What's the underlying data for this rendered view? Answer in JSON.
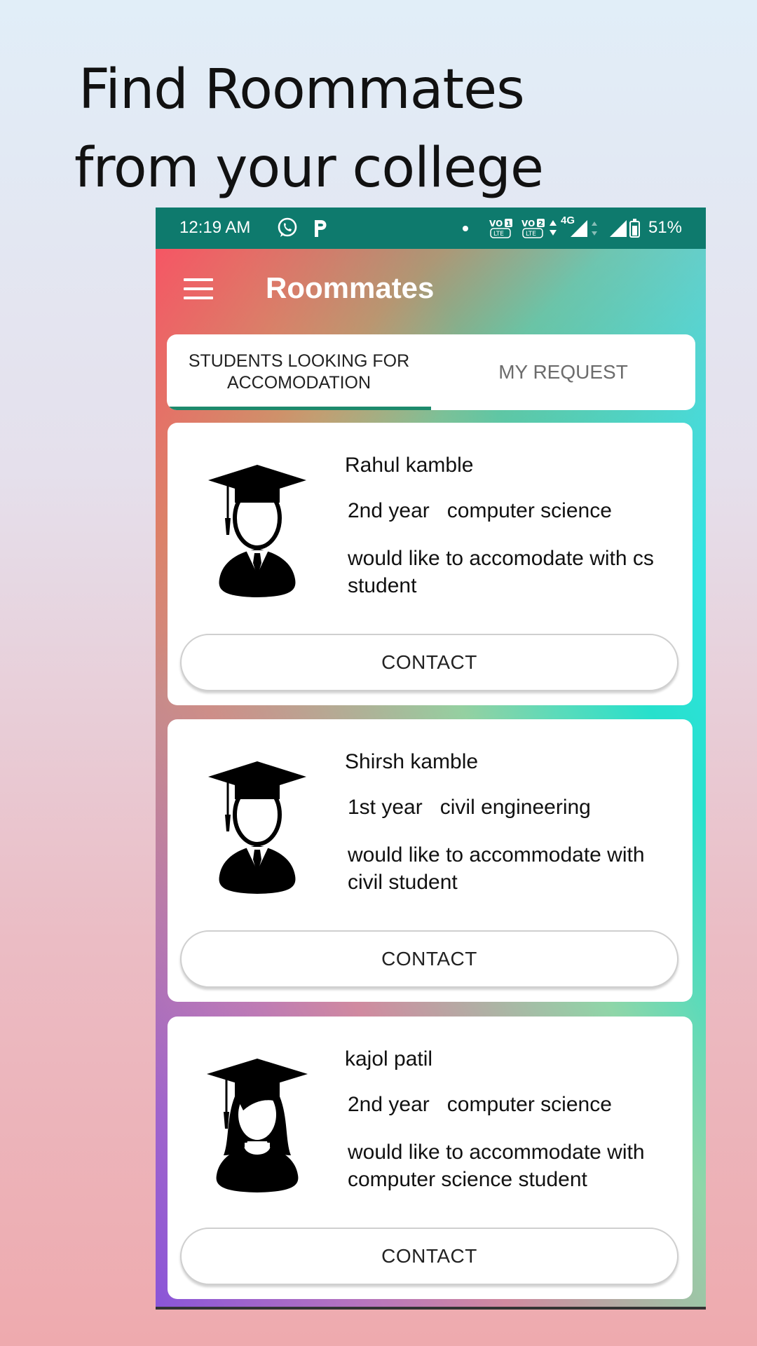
{
  "headline": {
    "line1": "Find Roommates",
    "line2": "from your college"
  },
  "status_bar": {
    "time": "12:19 AM",
    "network": "4G",
    "battery": "51%"
  },
  "app_bar": {
    "title": "Roommates"
  },
  "tabs": [
    {
      "label": "STUDENTS LOOKING FOR ACCOMODATION",
      "selected": true
    },
    {
      "label": "MY REQUEST",
      "selected": false
    }
  ],
  "colors": {
    "status_bar": "#0e7a6d",
    "tab_indicator": "#1d8a6c"
  },
  "students": [
    {
      "name": "Rahul kamble",
      "year": "2nd year",
      "department": "computer science",
      "preference": "would like to accomodate with cs student",
      "avatar": "male-graduate-icon",
      "contact_label": "CONTACT"
    },
    {
      "name": "Shirsh kamble",
      "year": "1st year",
      "department": "civil engineering",
      "preference": "would like to accommodate with civil student",
      "avatar": "male-graduate-icon",
      "contact_label": "CONTACT"
    },
    {
      "name": "kajol patil",
      "year": "2nd year",
      "department": "computer science",
      "preference": "would like to accommodate with computer science student",
      "avatar": "female-graduate-icon",
      "contact_label": "CONTACT"
    }
  ]
}
